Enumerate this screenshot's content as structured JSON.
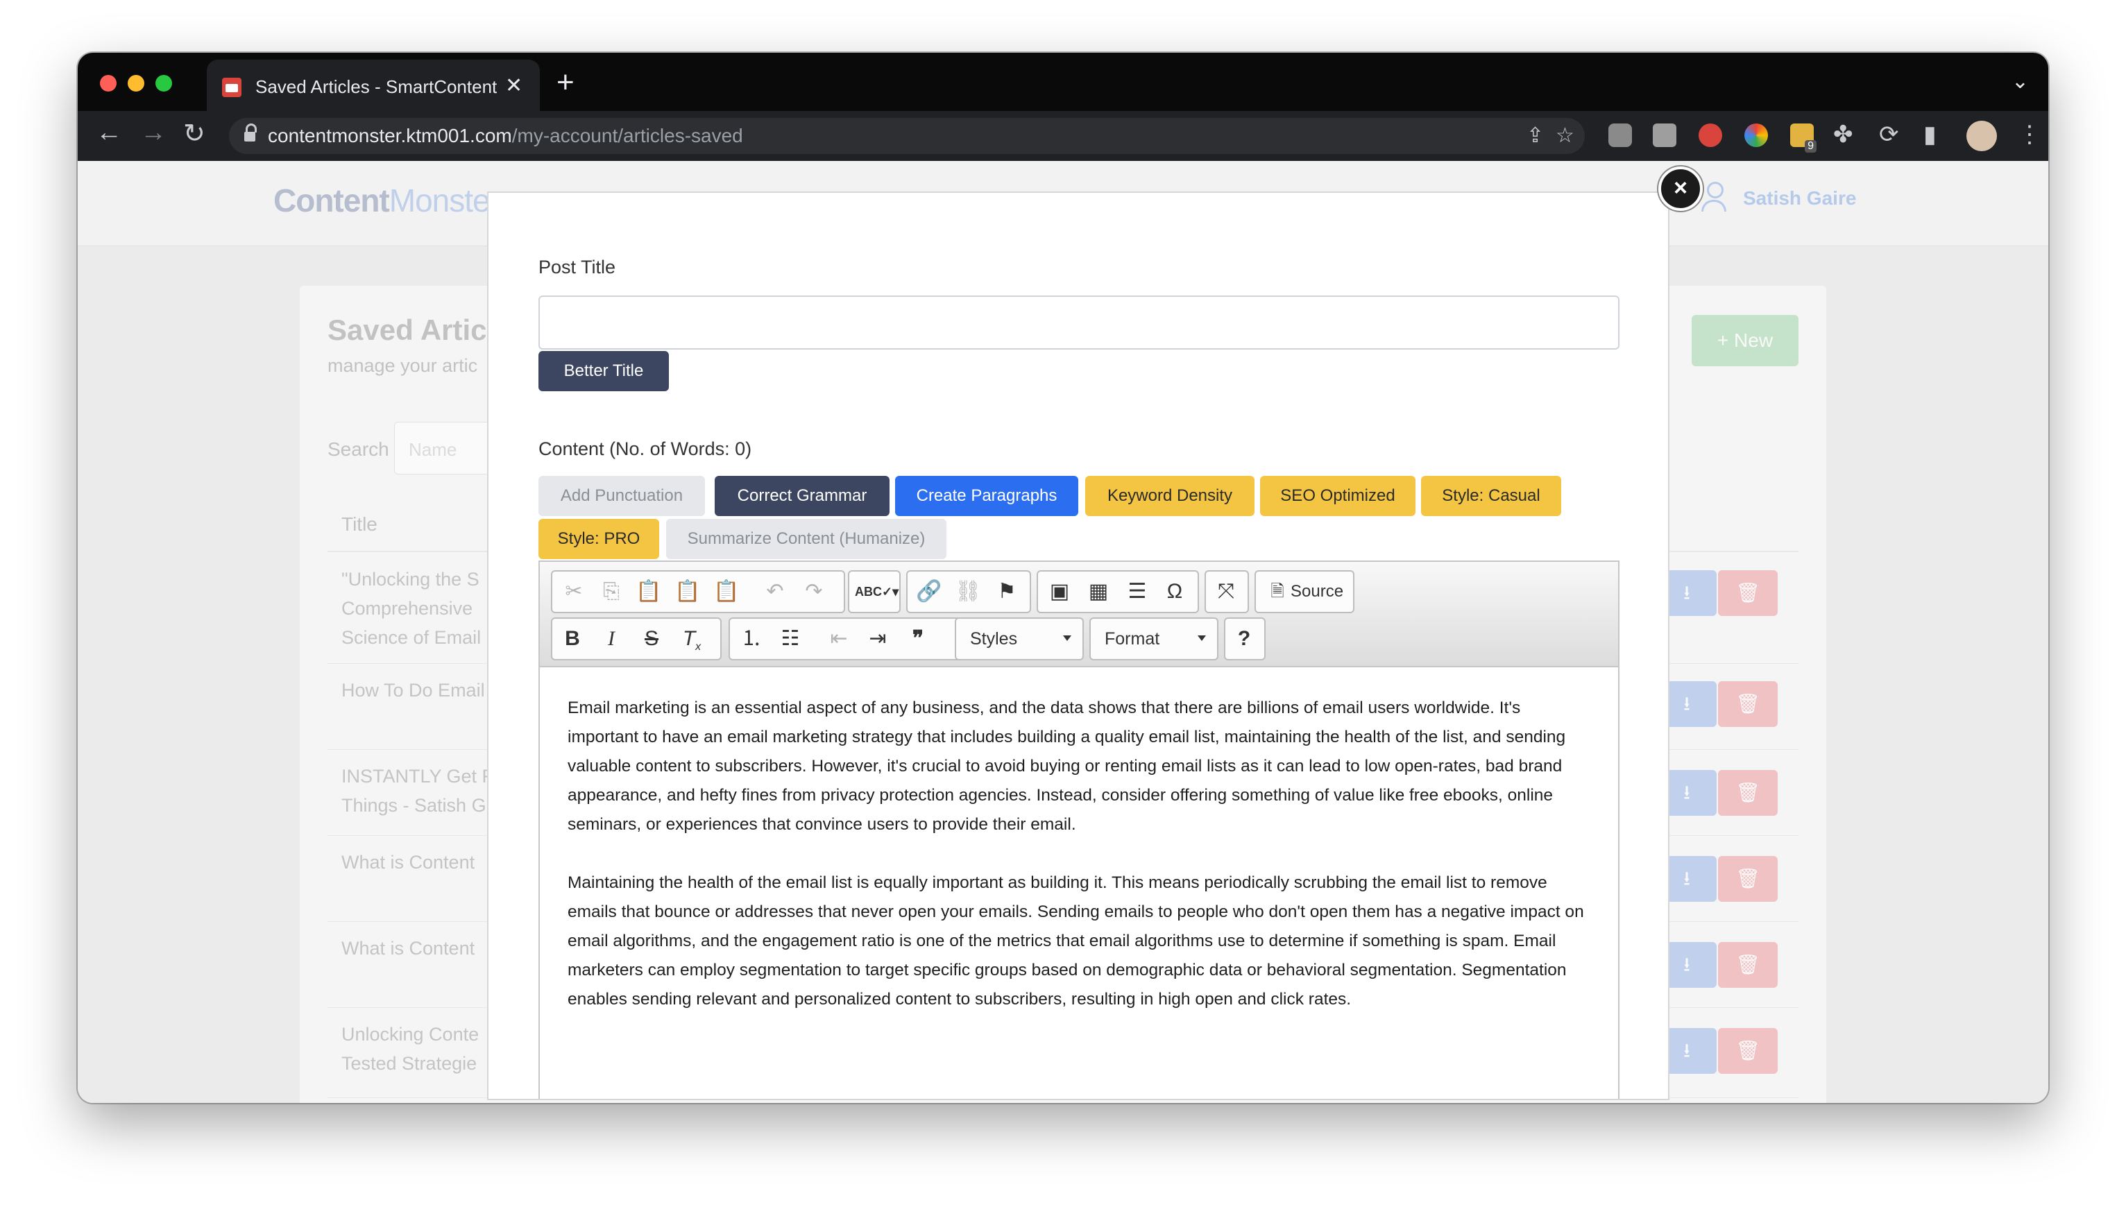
{
  "browser": {
    "tab_title": "Saved Articles - SmartContent",
    "url_host": "contentmonster.ktm001.com",
    "url_path": "/my-account/articles-saved",
    "extension_badge": "9"
  },
  "site": {
    "logo_bold": "Content",
    "logo_light": "Monste",
    "user_name": "Satish Gaire"
  },
  "background_page": {
    "title": "Saved Articl",
    "subtitle": "manage your artic",
    "new_button": "+ New",
    "search_label": "Search",
    "search_placeholder": "Name",
    "column_title": "Title",
    "rows": [
      "\"Unlocking the S\nComprehensive \nScience of Email",
      "How To Do Email",
      "INSTANTLY Get F\nThings - Satish G",
      "What is Content",
      "What is Content",
      "Unlocking Conte\nTested Strategie"
    ]
  },
  "modal": {
    "close_symbol": "×",
    "post_title_label": "Post Title",
    "post_title_value": "",
    "better_title_button": "Better Title",
    "content_label": "Content (No. of Words: 0)",
    "action_buttons": [
      {
        "label": "Add Punctuation",
        "style": "gray"
      },
      {
        "label": "Correct Grammar",
        "style": "dark"
      },
      {
        "label": "Create Paragraphs",
        "style": "blue"
      },
      {
        "label": "Keyword Density",
        "style": "yellow"
      },
      {
        "label": "SEO Optimized",
        "style": "yellow"
      },
      {
        "label": "Style: Casual",
        "style": "yellow"
      },
      {
        "label": "Style: PRO",
        "style": "yellow"
      },
      {
        "label": "Summarize Content (Humanize)",
        "style": "gray"
      }
    ],
    "editor": {
      "source_label": "Source",
      "styles_label": "Styles",
      "format_label": "Format",
      "help_label": "?",
      "paragraphs": [
        "Email marketing is an essential aspect of any business, and the data shows that there are billions of email users worldwide. It's important to have an email marketing strategy that includes building a quality email list, maintaining the health of the list, and sending valuable content to subscribers. However, it's crucial to avoid buying or renting email lists as it can lead to low open-rates, bad brand appearance, and hefty fines from privacy protection agencies. Instead, consider offering something of value like free ebooks, online seminars, or experiences that convince users to provide their email.",
        "Maintaining the health of the email list is equally important as building it. This means periodically scrubbing the email list to remove emails that bounce or addresses that never open your emails. Sending emails to people who don't open them has a negative impact on email algorithms, and the engagement ratio is one of the metrics that email algorithms use to determine if something is spam. Email marketers can employ segmentation to target specific groups based on demographic data or behavioral segmentation. Segmentation enables sending relevant and personalized content to subscribers, resulting in high open and click rates."
      ]
    }
  },
  "colors": {
    "dark_button": "#3d4660",
    "blue_button": "#2b6ef0",
    "yellow_button": "#f4c542",
    "gray_button": "#e5e7eb"
  }
}
